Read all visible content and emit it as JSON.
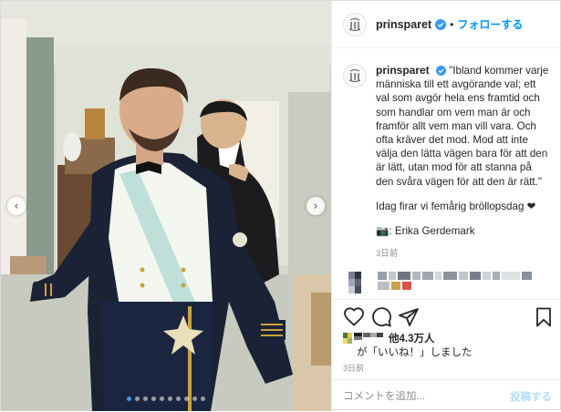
{
  "header": {
    "username": "prinsparet",
    "separator": "•",
    "follow_label": "フォローする"
  },
  "caption": {
    "username": "prinsparet",
    "quote": "\"Ibland kommer varje människa till ett avgörande val; ett val som avgör hela ens framtid och som handlar om vem man är och framför allt vem man vill vara. Och ofta kräver det mod. Mod att inte välja den lätta vägen bara för att den är lätt, utan mod för att stanna på den svåra vägen för att den är rätt.\"",
    "celebration": "Idag firar vi femårig bröllopsdag ❤",
    "photo_credit": "📷: Erika Gerdemark",
    "time": "3日前"
  },
  "actions": {
    "likes_suffix": "他4.3万人",
    "liked_text": "が「いいね！」しました",
    "time": "3日前"
  },
  "comment_box": {
    "placeholder": "コメントを追加...",
    "post_label": "投稿する"
  },
  "carousel": {
    "total": 10,
    "active_index": 0
  },
  "colors": {
    "accent": "#0095f6",
    "verified": "#3897f0"
  }
}
